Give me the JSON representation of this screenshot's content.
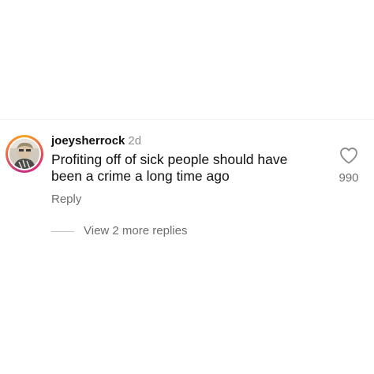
{
  "comment": {
    "username": "joeysherrock",
    "time_ago": "2d",
    "text": "Profiting off of sick people should have been a crime a long time ago",
    "like_count": "990",
    "like_icon": "heart-outline-icon",
    "reply_label": "Reply",
    "view_replies_label": "View 2 more replies",
    "avatar_ring_colors": [
      "#f5a623",
      "#e1306c",
      "#c13584",
      "#f77737"
    ]
  }
}
